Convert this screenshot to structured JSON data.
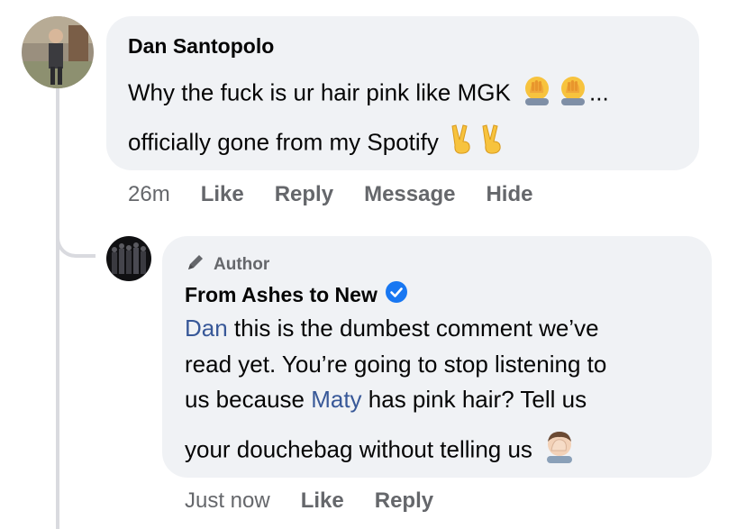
{
  "comment": {
    "author": "Dan Santopolo",
    "line1": "Why the fuck is ur hair pink like MGK",
    "line1_ellipsis": "...",
    "line2": "officially gone from my Spotify",
    "time": "26m",
    "actions": [
      "Like",
      "Reply",
      "Message",
      "Hide"
    ],
    "emoji_line1": [
      "face-palm-icon",
      "face-palm-icon"
    ],
    "emoji_line2": [
      "victory-hand-icon",
      "victory-hand-icon"
    ]
  },
  "reply": {
    "badge": "Author",
    "author": "From Ashes to New",
    "mention1": "Dan",
    "line1_rest": " this is the dumbest comment we’ve",
    "line2": "read yet. You’re going to stop listening to",
    "line3_pre": "us because ",
    "mention2": "Maty",
    "line3_post": " has pink hair? Tell us",
    "line4": "your douchebag without telling us",
    "time": "Just now",
    "actions": [
      "Like",
      "Reply"
    ],
    "emoji_line4": "man-facepalming-icon"
  },
  "colors": {
    "bubble": "#f0f2f5",
    "secondary_text": "#65676b",
    "mention": "#385898",
    "verified": "#1877f2",
    "thread_line": "#d9dadf"
  }
}
